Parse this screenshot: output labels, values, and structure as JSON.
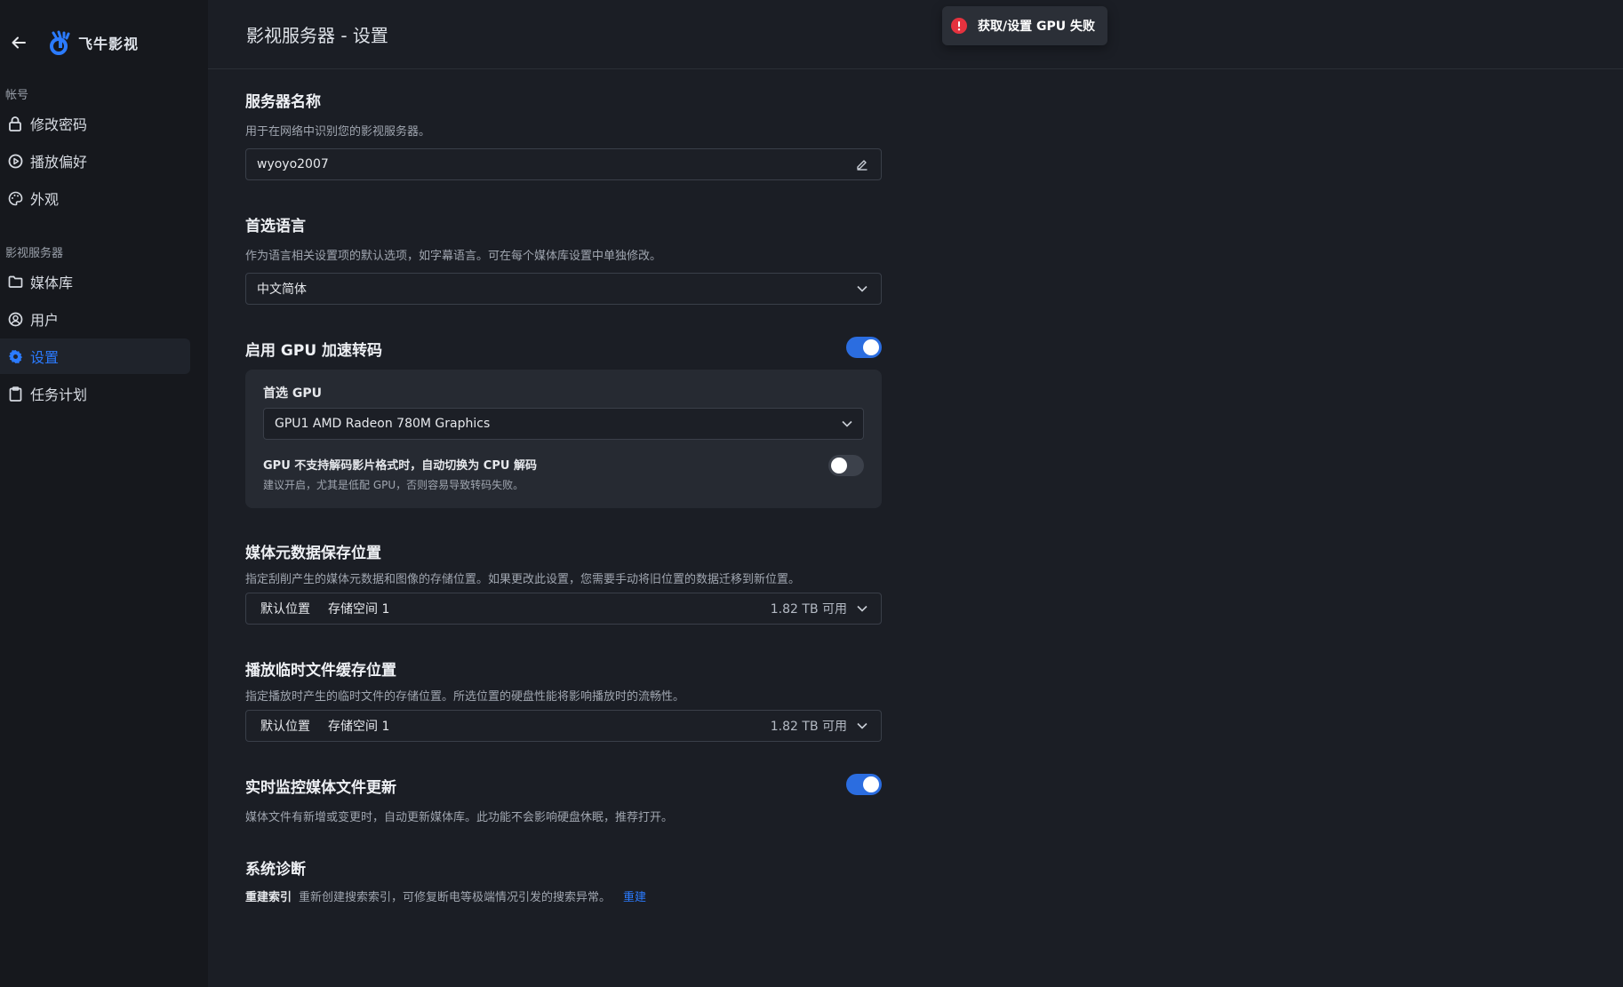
{
  "sidebar": {
    "brand_name": "飞牛影视",
    "groups": [
      {
        "title": "帐号",
        "items": [
          {
            "label": "修改密码",
            "icon": "lock-icon"
          },
          {
            "label": "播放偏好",
            "icon": "play-circle-icon"
          },
          {
            "label": "外观",
            "icon": "palette-icon"
          }
        ]
      },
      {
        "title": "影视服务器",
        "items": [
          {
            "label": "媒体库",
            "icon": "folder-icon"
          },
          {
            "label": "用户",
            "icon": "user-circle-icon"
          },
          {
            "label": "设置",
            "icon": "gear-icon",
            "active": true
          },
          {
            "label": "任务计划",
            "icon": "clipboard-icon"
          }
        ]
      }
    ]
  },
  "header": {
    "title": "影视服务器 - 设置"
  },
  "toast": {
    "message": "获取/设置 GPU 失败",
    "color": "#e5323e"
  },
  "server_name": {
    "title": "服务器名称",
    "desc": "用于在网络中识别您的影视服务器。",
    "value": "wyoyo2007"
  },
  "language": {
    "title": "首选语言",
    "desc": "作为语言相关设置项的默认选项，如字幕语言。可在每个媒体库设置中单独修改。",
    "value": "中文简体"
  },
  "gpu": {
    "title": "启用 GPU 加速转码",
    "enabled": true,
    "preferred_label": "首选 GPU",
    "preferred_value": "GPU1 AMD Radeon 780M Graphics",
    "fallback_title": "GPU 不支持解码影片格式时，自动切换为 CPU 解码",
    "fallback_desc": "建议开启，尤其是低配 GPU，否则容易导致转码失败。",
    "fallback_enabled": false
  },
  "metadata": {
    "title": "媒体元数据保存位置",
    "desc": "指定刮削产生的媒体元数据和图像的存储位置。如果更改此设置，您需要手动将旧位置的数据迁移到新位置。",
    "location_tag": "默认位置",
    "location_name": "存储空间 1",
    "free": "1.82 TB 可用"
  },
  "cache": {
    "title": "播放临时文件缓存位置",
    "desc": "指定播放时产生的临时文件的存储位置。所选位置的硬盘性能将影响播放时的流畅性。",
    "location_tag": "默认位置",
    "location_name": "存储空间 1",
    "free": "1.82 TB 可用"
  },
  "monitor": {
    "title": "实时监控媒体文件更新",
    "desc": "媒体文件有新增或变更时，自动更新媒体库。此功能不会影响硬盘休眠，推荐打开。",
    "enabled": true
  },
  "diagnostics": {
    "title": "系统诊断",
    "reindex_label": "重建索引",
    "reindex_desc": "重新创建搜索索引，可修复断电等极端情况引发的搜索异常。",
    "reindex_action": "重建"
  },
  "colors": {
    "accent": "#2b7bff",
    "toggle_on": "#2b6de0"
  }
}
